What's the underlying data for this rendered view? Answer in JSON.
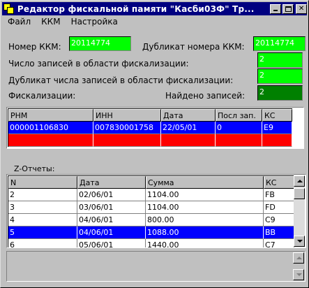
{
  "window": {
    "title": "Редактор фискальной памяти \"Касби03Ф\" Тр..."
  },
  "menu": [
    {
      "label": "Файл"
    },
    {
      "label": "ККМ"
    },
    {
      "label": "Настройка"
    }
  ],
  "form": {
    "kkm_number_label": "Номер ККМ:",
    "kkm_number_value": "20114774",
    "kkm_dup_label": "Дубликат номера ККМ:",
    "kkm_dup_value": "20114774",
    "records_count_label": "Число записей в области фискализации:",
    "records_count_value": "2",
    "records_dup_label": "Дубликат числа записей в области фискализации:",
    "records_dup_value": "2",
    "fiscalization_label": "Фискализации:",
    "found_label": "Найдено записей:",
    "found_value": "2"
  },
  "fiscal_table": {
    "columns": [
      "РНМ",
      "ИНН",
      "Дата",
      "Посл зап.",
      "КС"
    ],
    "rows": [
      [
        "000001106830",
        "007830001758",
        "22/05/01",
        "0",
        "E9"
      ],
      [
        "",
        "",
        "",
        "",
        ""
      ]
    ]
  },
  "zreports": {
    "label": "Z-Отчеты:",
    "columns": [
      "N",
      "Дата",
      "Сумма",
      "КС"
    ],
    "rows": [
      [
        "2",
        "02/06/01",
        "1104.00",
        "FB"
      ],
      [
        "3",
        "03/06/01",
        "1104.00",
        "FD"
      ],
      [
        "4",
        "04/06/01",
        "800.00",
        "C9"
      ],
      [
        "5",
        "04/06/01",
        "1088.00",
        "BB"
      ],
      [
        "6",
        "05/06/01",
        "1440.00",
        "C7"
      ]
    ],
    "selected_row": 3
  },
  "colors": {
    "titlebar": "#000080",
    "field_bright": "#00ff00",
    "field_dark": "#008000",
    "selection": "#0000ff",
    "error_row": "#ff0000"
  }
}
